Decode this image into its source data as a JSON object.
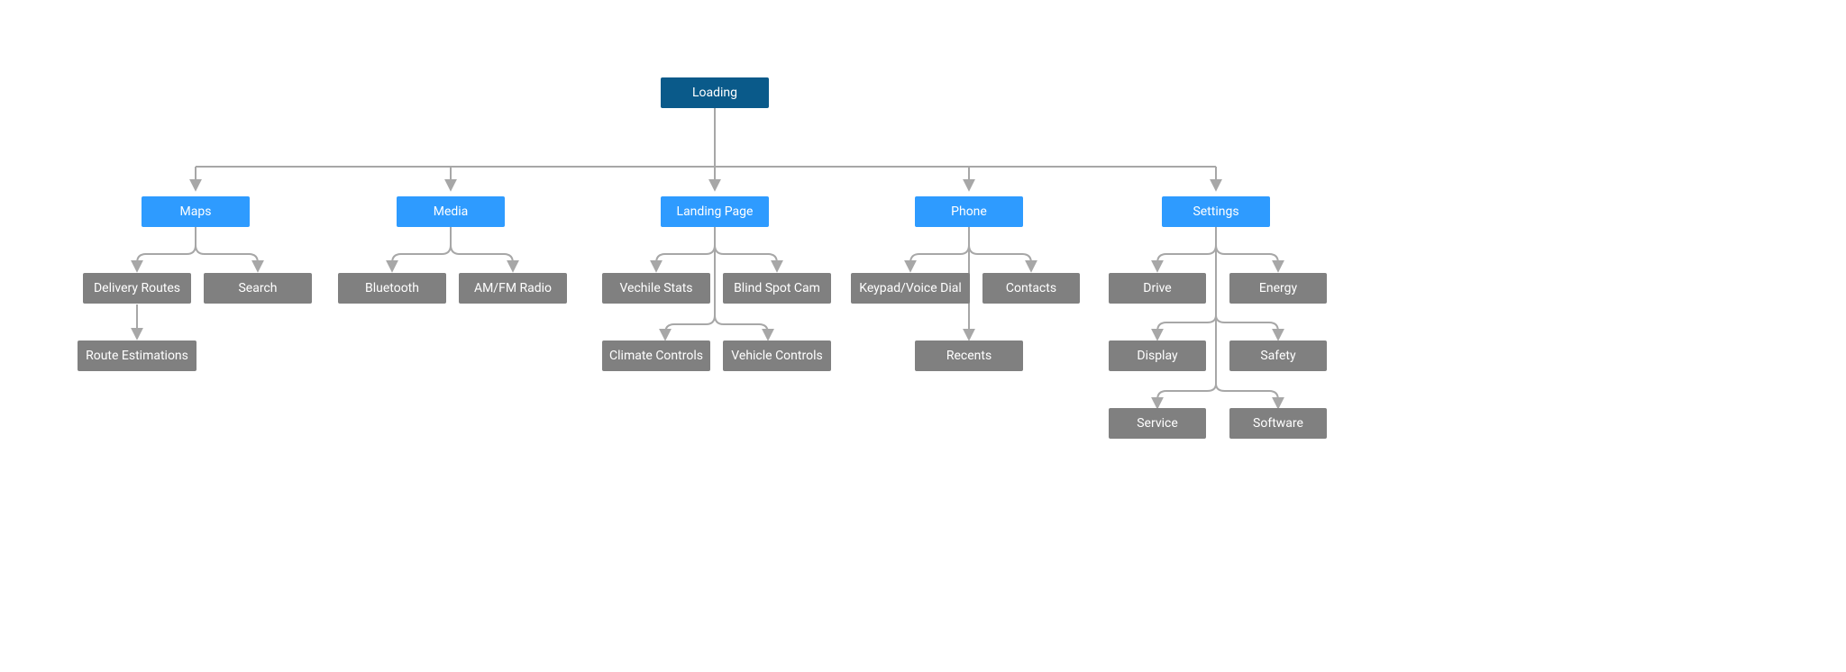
{
  "diagram": {
    "type": "sitemap",
    "root": {
      "label": "Loading"
    },
    "branches": [
      {
        "label": "Maps",
        "children": [
          {
            "label": "Delivery Routes",
            "children": [
              {
                "label": "Route Estimations"
              }
            ]
          },
          {
            "label": "Search"
          }
        ]
      },
      {
        "label": "Media",
        "children": [
          {
            "label": "Bluetooth"
          },
          {
            "label": "AM/FM Radio"
          }
        ]
      },
      {
        "label": "Landing Page",
        "children": [
          {
            "label": "Vechile Stats"
          },
          {
            "label": "Blind Spot Cam"
          },
          {
            "label": "Climate Controls"
          },
          {
            "label": "Vehicle Controls"
          }
        ]
      },
      {
        "label": "Phone",
        "children": [
          {
            "label": "Keypad/Voice Dial"
          },
          {
            "label": "Contacts"
          },
          {
            "label": "Recents"
          }
        ]
      },
      {
        "label": "Settings",
        "children": [
          {
            "label": "Drive"
          },
          {
            "label": "Energy"
          },
          {
            "label": "Display"
          },
          {
            "label": "Safety"
          },
          {
            "label": "Service"
          },
          {
            "label": "Software"
          }
        ]
      }
    ]
  },
  "colors": {
    "root": "#0a5a8a",
    "branch": "#2e9bff",
    "leaf": "#808080",
    "connector": "#a7a7a7"
  }
}
